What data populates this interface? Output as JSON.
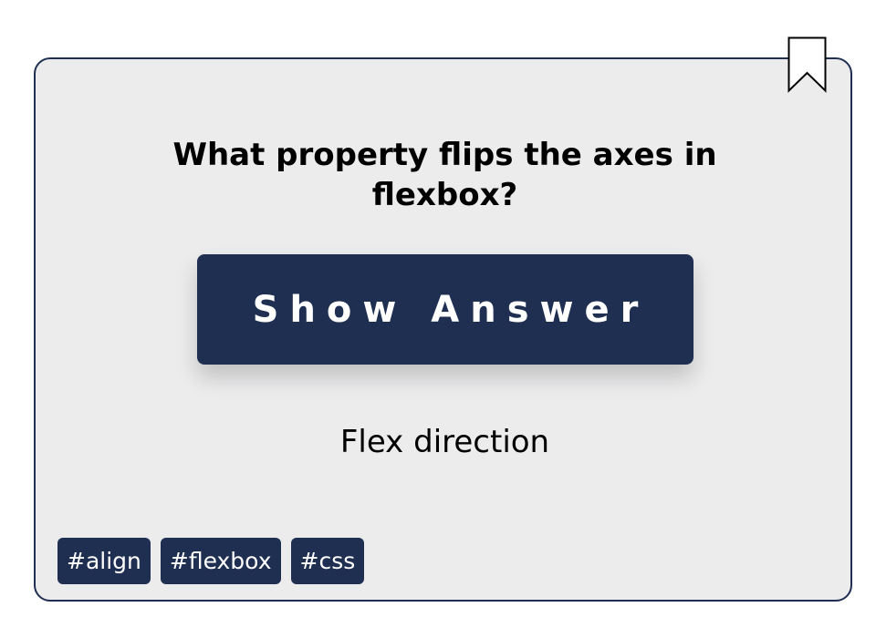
{
  "card": {
    "question": "What property flips the axes in flexbox?",
    "show_answer_label": "Show Answer",
    "answer": "Flex direction",
    "tags": [
      "#align",
      "#flexbox",
      "#css"
    ]
  },
  "icons": {
    "bookmark": "bookmark-icon"
  },
  "colors": {
    "accent": "#1f2f52",
    "card_background": "#ececed",
    "text": "#000000"
  }
}
